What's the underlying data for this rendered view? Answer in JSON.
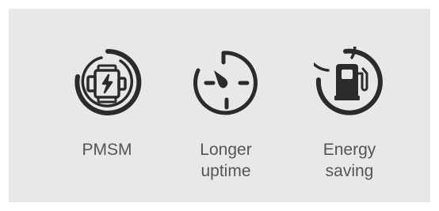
{
  "colors": {
    "background": "#ffffff",
    "panel": "#e8e8e8",
    "icon": "#2b2b2b",
    "text": "#555555"
  },
  "features": [
    {
      "icon": "motor-icon",
      "label": "PMSM"
    },
    {
      "icon": "stopwatch-icon",
      "label": "Longer\nuptime"
    },
    {
      "icon": "fuel-pump-icon",
      "label": "Energy\nsaving"
    }
  ]
}
